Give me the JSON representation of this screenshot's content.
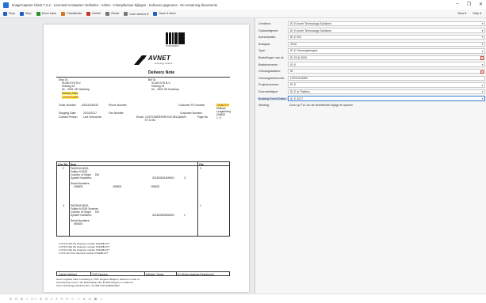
{
  "window": {
    "title": "ImageCapture Client 7.2.2 - Licensed to Maarten Verlinden - Admin - Inkoopfactuur bijlagen - Indexeer gegevens - No remaining documents",
    "controls": [
      "–",
      "❐",
      "✕"
    ]
  },
  "toolbar": {
    "items": [
      {
        "label": "Stop",
        "icon": "stop-icon",
        "color": "#1f5fbf"
      },
      {
        "label": "Stop",
        "icon": "pause-icon",
        "color": "#1f5fbf"
      },
      {
        "label": "Move back",
        "icon": "back-icon",
        "color": "#2a8f2a"
      },
      {
        "label": "Classificate",
        "icon": "classify-icon",
        "color": "#d1731f"
      },
      {
        "label": "Delete",
        "icon": "delete-icon",
        "color": "#c0392b"
      },
      {
        "label": "Reset",
        "icon": "reset-icon",
        "color": "#777777"
      },
      {
        "label": "User actions ▾",
        "icon": "user-icon",
        "color": "#777777"
      },
      {
        "label": "Save & Next",
        "icon": "save-icon",
        "color": "#1f5fbf"
      }
    ],
    "right": [
      "View ▾",
      "Help ▾"
    ]
  },
  "document": {
    "barcode_number": "IC0012345678",
    "logo_text": "AVNET",
    "logo_sub": "technology solutions",
    "title": "Delivery Note",
    "ship_to_label": "Ship To:",
    "ship_to_lines": [
      "SCAN SYS B.V.",
      "Hofweg 23",
      "NL - 2631 XE Nootdorp"
    ],
    "delivery_note_label": "Delivery Note",
    "delivery_note_no": "L2011024089",
    "bill_to_label": "Bill To:",
    "bill_to_lines": [
      "SCAN SYS B.V.",
      "Hofweg 23",
      "NL - 2631 XE Nootdorp"
    ],
    "order_number_label": "Order Number:",
    "order_number": "A2011300043",
    "phone_label": "Phone Number",
    "customer_po_label": "Customer PO Number",
    "customer_po": "200867FH",
    "contact_lines": [
      "Melissa",
      "Lengenberg",
      "206622"
    ],
    "shipping_date_label": "Shipping Date:",
    "shipping_date": "21/01/2017",
    "fax_label": "Fax Number:",
    "customer_number_label": "Customer Number:",
    "customer_number": "206622",
    "contact_person_label": "Contact Person:",
    "contact_person": "Levi Verhoeven",
    "email_label": "Email:",
    "email": "CUSTOMERSERVICE.BNL@AVN ET.COM",
    "page_label": "Page No.",
    "page_value": "1 / 1",
    "table": {
      "headers": [
        "Line No",
        "Item",
        "Qty"
      ],
      "rows": [
        {
          "line": "2",
          "item": "PA00940-B001",
          "desc": "Fujitsu fi-6130",
          "origin_label": "Country of Origin",
          "origin": "DN",
          "sysnum_label": "System Numbers:",
          "sysnum": "311300601609001",
          "sysqty": "3",
          "serial_label": "Serial Numbers:",
          "serials": [
            "155605",
            "155603",
            "155625"
          ],
          "qty": "3"
        },
        {
          "line": "4",
          "item": "PA03540-B001",
          "desc": "Fujitsu fi-6230 Scanner",
          "origin_label": "Country of Origin",
          "origin": "DN",
          "sysnum_label": "System Numbers:",
          "sysnum": "311300600604001",
          "sysqty": "1",
          "serial_label": "Serial Numbers:",
          "serials": [
            "063620"
          ],
          "qty": "1"
        }
      ]
    },
    "shipments": [
      "1 PCS 8.434 KG   shipment number P3418B-K7T",
      "1 PCS 8.434 KG   shipment number P3418B-K7T",
      "1 PCS 8.434 KG   shipment number P3418B-K7T",
      "1 PCS 12.0 KG    shipment number P3418B-K7T"
    ],
    "carrier": {
      "method_label": "Carrier Method",
      "method": "TNT Express",
      "terms_label": "Delivery Terms",
      "terms": "Ex Works (against Reimburse)"
    },
    "footer_lines": [
      "Avnet Logistics India, Limesweg 4, 3700 Tongeren Belgium; delivers in order of",
      "Avnet Europe Comm. VA, Woluwelaan 146, B-1831 Diegem, is a client of",
      "Avnet Technology Solutions B.V., NL 5657 EG EINDHOVEN"
    ]
  },
  "statusbar": {
    "items": [
      "⊞",
      "⊟",
      "⊠",
      "1",
      "1 / 1",
      "⊞",
      "⊟",
      "Z",
      "Z",
      "⟲",
      "⟳",
      "✂",
      "☐",
      "⊕",
      "⊗",
      "▦",
      "▭"
    ]
  },
  "fields": [
    {
      "label": "Crediteur:",
      "value": "ID  ⚲  Avnet Technology Solutions",
      "type": "dropdown"
    },
    {
      "label": "Opdrachtgever:",
      "value": "ID  ⚲  Avnet Technology Solutions",
      "type": "dropdown"
    },
    {
      "label": "Administratie:",
      "value": "ID  ⚲  001",
      "type": "dropdown"
    },
    {
      "label": "Boekjaar:",
      "value": "2018",
      "type": "dropdown"
    },
    {
      "label": "Type:",
      "value": "ID  ⚲  Ontvangstregels",
      "type": "dropdown"
    },
    {
      "label": "Bestellingen van af:",
      "value": "ID  22-6-2000",
      "type": "date"
    },
    {
      "label": "Bestelnummer:",
      "value": "ID  ⚲",
      "type": "dropdown"
    },
    {
      "label": "Ontvangstdatum:",
      "value": "ID",
      "type": "date"
    },
    {
      "label": "Ontvangstreferentie:",
      "value": "L2011024089",
      "type": "text"
    },
    {
      "label": "Projectnummer:",
      "value": "ID  ⚲",
      "type": "dropdown"
    },
    {
      "label": "Documenttype:",
      "value": "ID  ⚲  ★  Pakbon",
      "type": "dropdown"
    },
    {
      "label": "Booking Event Dates:",
      "value": "ID  ⚲  2017",
      "type": "dropdown",
      "selected": true
    },
    {
      "label": "Melding:",
      "value": "Druk op F12 om de betreffende bijlage te openen",
      "type": "plain"
    }
  ]
}
